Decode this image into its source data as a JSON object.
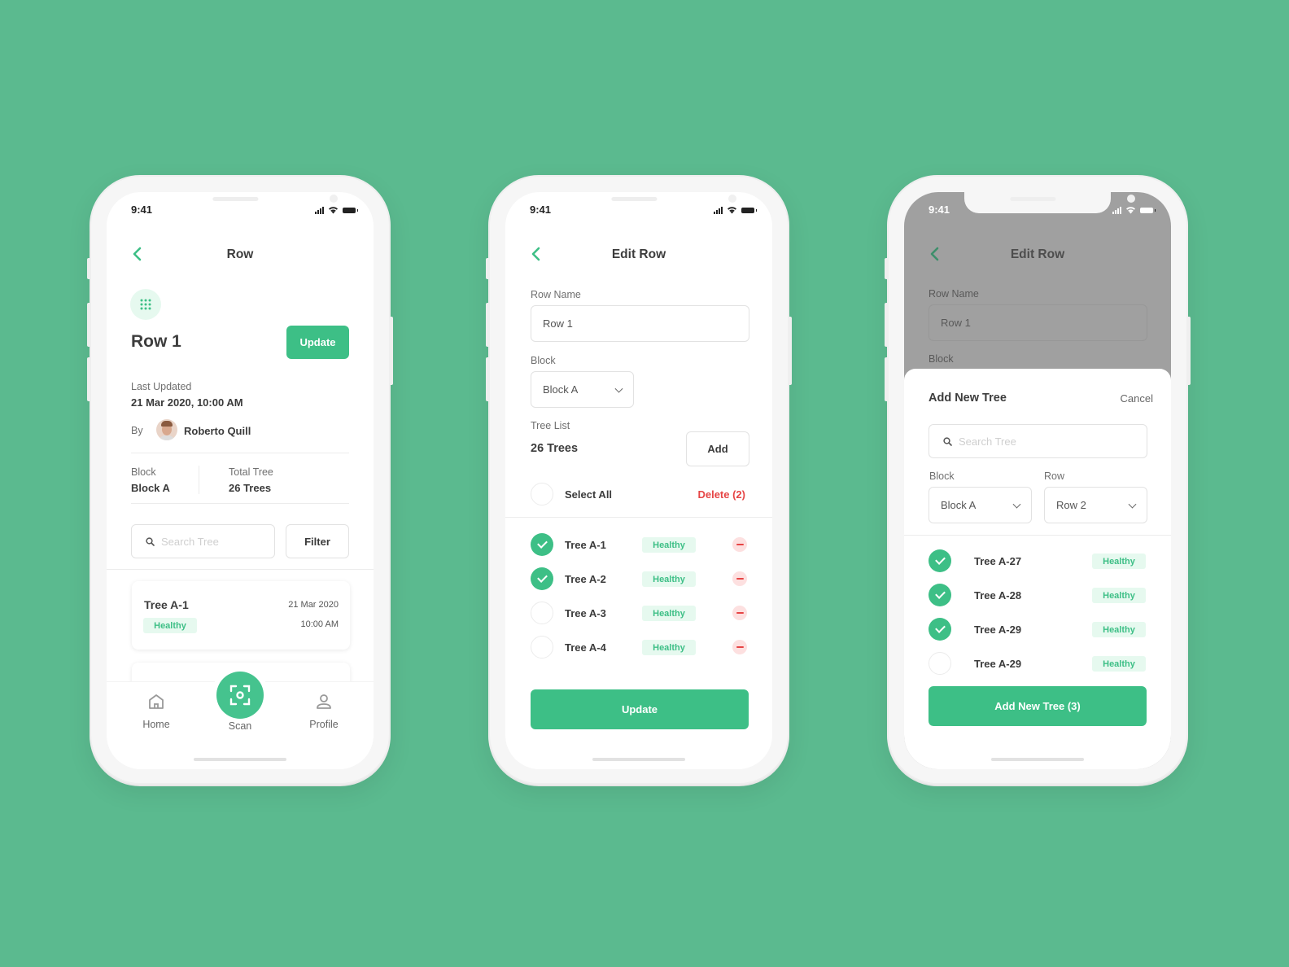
{
  "colors": {
    "background": "#5bba8f",
    "accent": "#3dbf86",
    "danger": "#e64545",
    "badge_bg": "#e6f9ef"
  },
  "status_bar": {
    "time": "9:41"
  },
  "screen1": {
    "nav_title": "Row",
    "row_icon": "grid-dots-icon",
    "row_title": "Row 1",
    "update_label": "Update",
    "last_updated_label": "Last Updated",
    "last_updated_value": "21 Mar 2020, 10:00 AM",
    "by_label": "By",
    "author": "Roberto Quill",
    "block_label": "Block",
    "block_value": "Block A",
    "total_label": "Total Tree",
    "total_value": "26 Trees",
    "search_placeholder": "Search Tree",
    "filter_label": "Filter",
    "cards": [
      {
        "name": "Tree A-1",
        "status": "Healthy",
        "date": "21 Mar 2020",
        "time": "10:00 AM"
      }
    ],
    "tabbar": [
      {
        "label": "Home",
        "icon": "home-icon"
      },
      {
        "label": "Scan",
        "icon": "scan-icon"
      },
      {
        "label": "Profile",
        "icon": "profile-icon"
      }
    ]
  },
  "screen2": {
    "nav_title": "Edit Row",
    "row_name_label": "Row Name",
    "row_name_value": "Row 1",
    "block_label": "Block",
    "block_value": "Block A",
    "tree_list_label": "Tree List",
    "tree_count": "26 Trees",
    "add_label": "Add",
    "select_all_label": "Select All",
    "delete_label": "Delete (2)",
    "trees": [
      {
        "name": "Tree A-1",
        "status": "Healthy",
        "checked": true
      },
      {
        "name": "Tree A-2",
        "status": "Healthy",
        "checked": true
      },
      {
        "name": "Tree A-3",
        "status": "Healthy",
        "checked": false
      },
      {
        "name": "Tree A-4",
        "status": "Healthy",
        "checked": false
      }
    ],
    "update_label": "Update"
  },
  "screen3": {
    "nav_title": "Edit Row",
    "row_name_label": "Row Name",
    "row_name_value": "Row 1",
    "block_label_bg": "Block",
    "sheet_title": "Add New Tree",
    "cancel_label": "Cancel",
    "search_placeholder": "Search Tree",
    "block_label": "Block",
    "block_value": "Block A",
    "row_label": "Row",
    "row_value": "Row 2",
    "trees": [
      {
        "name": "Tree A-27",
        "status": "Healthy",
        "checked": true
      },
      {
        "name": "Tree A-28",
        "status": "Healthy",
        "checked": true
      },
      {
        "name": "Tree A-29",
        "status": "Healthy",
        "checked": true
      },
      {
        "name": "Tree A-29",
        "status": "Healthy",
        "checked": false
      }
    ],
    "add_button_label": "Add New Tree (3)"
  }
}
